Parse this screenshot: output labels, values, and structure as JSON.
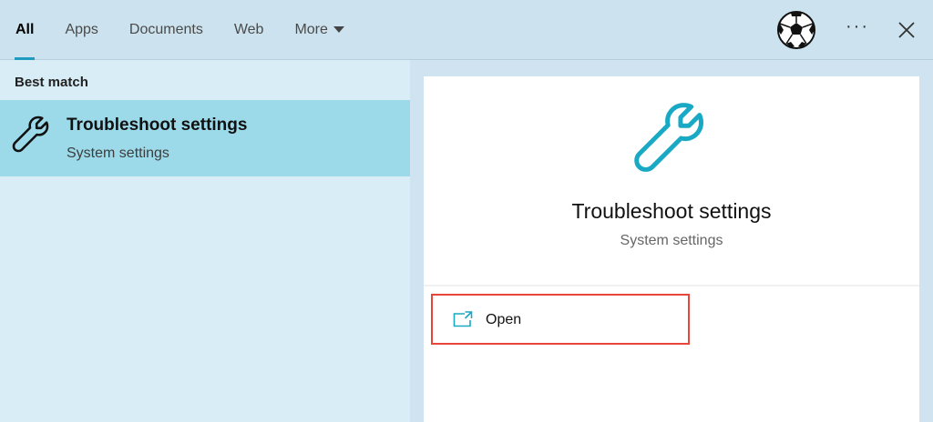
{
  "tabs": [
    {
      "label": "All",
      "active": true
    },
    {
      "label": "Apps",
      "active": false
    },
    {
      "label": "Documents",
      "active": false
    },
    {
      "label": "Web",
      "active": false
    },
    {
      "label": "More",
      "active": false
    }
  ],
  "header": {
    "more_menu_icon": "ellipsis-icon",
    "close_icon": "close-icon",
    "avatar_icon": "soccer-ball-icon",
    "more_menu_label": "···"
  },
  "results": {
    "section_label": "Best match",
    "best_match": {
      "title": "Troubleshoot settings",
      "subtitle": "System settings",
      "icon": "wrench-icon"
    }
  },
  "detail": {
    "title": "Troubleshoot settings",
    "subtitle": "System settings",
    "icon": "wrench-icon",
    "actions": [
      {
        "label": "Open",
        "icon": "open-icon"
      }
    ]
  },
  "colors": {
    "accent": "#1e9bbf",
    "selection": "#9cdaea",
    "highlight_border": "#e8463b"
  }
}
